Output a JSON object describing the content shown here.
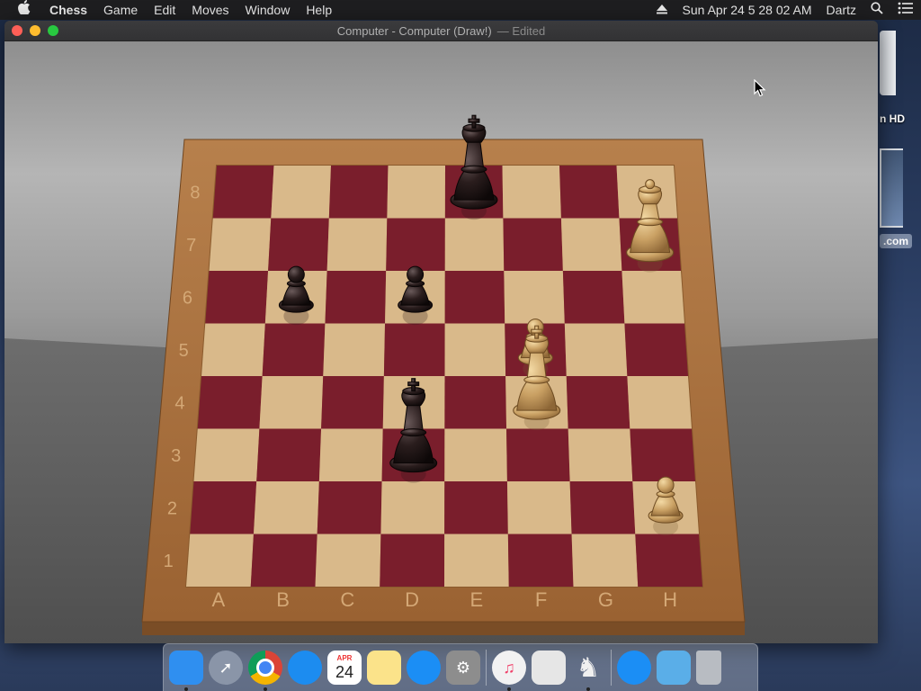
{
  "menubar": {
    "app_name": "Chess",
    "menus": [
      "Game",
      "Edit",
      "Moves",
      "Window",
      "Help"
    ],
    "datetime": "Sun Apr 24  5 28 02 AM",
    "user": "Dartz"
  },
  "desktop": {
    "disk_label": "n HD",
    "web_label": ".com"
  },
  "window": {
    "title": "Computer - Computer   (Draw!)",
    "title_suffix": "— Edited"
  },
  "board": {
    "files": [
      "A",
      "B",
      "C",
      "D",
      "E",
      "F",
      "G",
      "H"
    ],
    "ranks": [
      "1",
      "2",
      "3",
      "4",
      "5",
      "6",
      "7",
      "8"
    ],
    "light_color": "#d9b98a",
    "dark_color": "#7a1e2c",
    "frame_color": "#a8703e",
    "pieces": [
      {
        "piece": "king",
        "color": "black",
        "square": "e8"
      },
      {
        "piece": "pawn",
        "color": "black",
        "square": "b6"
      },
      {
        "piece": "pawn",
        "color": "black",
        "square": "d6"
      },
      {
        "piece": "king",
        "color": "black",
        "square": "d3"
      },
      {
        "piece": "queen",
        "color": "white",
        "square": "h7"
      },
      {
        "piece": "pawn",
        "color": "white",
        "square": "f5"
      },
      {
        "piece": "king",
        "color": "white",
        "square": "f4"
      },
      {
        "piece": "pawn",
        "color": "white",
        "square": "h2"
      }
    ]
  },
  "dock": {
    "calendar_month": "APR",
    "calendar_day": "24",
    "items": [
      {
        "name": "finder-icon",
        "color": "#2f8ff0"
      },
      {
        "name": "launchpad-icon",
        "color": "#8a95a8"
      },
      {
        "name": "chrome-icon",
        "color": "#e9e9e9"
      },
      {
        "name": "safari-icon",
        "color": "#1c8cf0"
      },
      {
        "name": "calendar-icon",
        "color": "#ffffff"
      },
      {
        "name": "notes-icon",
        "color": "#fbe38a"
      },
      {
        "name": "app-store-icon",
        "color": "#1b8ef5"
      },
      {
        "name": "system-preferences-icon",
        "color": "#8d8d8d"
      },
      {
        "name": "music-icon",
        "color": "#f2f2f2"
      },
      {
        "name": "preview-icon",
        "color": "#e6e6e6"
      },
      {
        "name": "chess-icon",
        "color": "#6d6d6d"
      },
      {
        "name": "app-store-downloads-icon",
        "color": "#1b8ef5"
      },
      {
        "name": "downloads-folder-icon",
        "color": "#5aaee8"
      },
      {
        "name": "trash-icon",
        "color": "#b8bcc2"
      }
    ]
  }
}
